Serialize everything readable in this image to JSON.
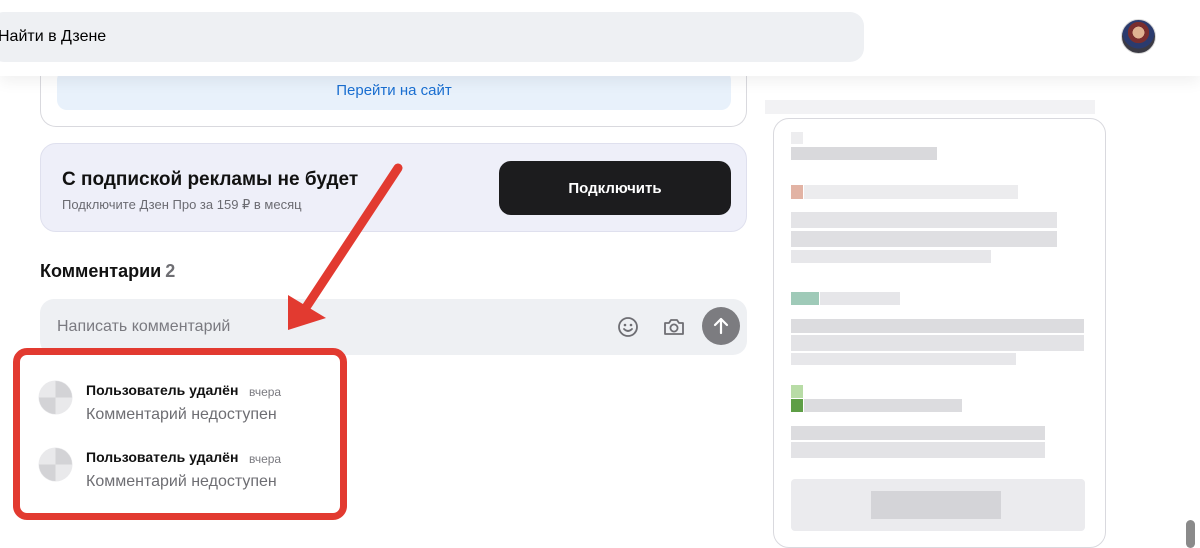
{
  "header": {
    "search_placeholder": "Найти в Дзене",
    "avatar_icon": "user-avatar"
  },
  "site_card": {
    "button_label": "Перейти на сайт"
  },
  "promo": {
    "title": "С подпиской рекламы не будет",
    "subtitle": "Подключите Дзен Про за 159 ₽ в месяц",
    "button_label": "Подключить"
  },
  "comments": {
    "heading": "Комментарии",
    "count": "2",
    "input_placeholder": "Написать комментарий",
    "icons": [
      "emoji-icon",
      "camera-icon",
      "send-arrow-icon"
    ],
    "items": [
      {
        "author": "Пользователь удалён",
        "time": "вчера",
        "text": "Комментарий недоступен"
      },
      {
        "author": "Пользователь удалён",
        "time": "вчера",
        "text": "Комментарий недоступен"
      }
    ]
  },
  "annotation": {
    "color": "#e23a30"
  },
  "colors": {
    "link": "#1a6fd1",
    "promo_bg": "#eeeff9",
    "dark_button": "#1c1c1e",
    "input_bg": "#eef0f3"
  }
}
